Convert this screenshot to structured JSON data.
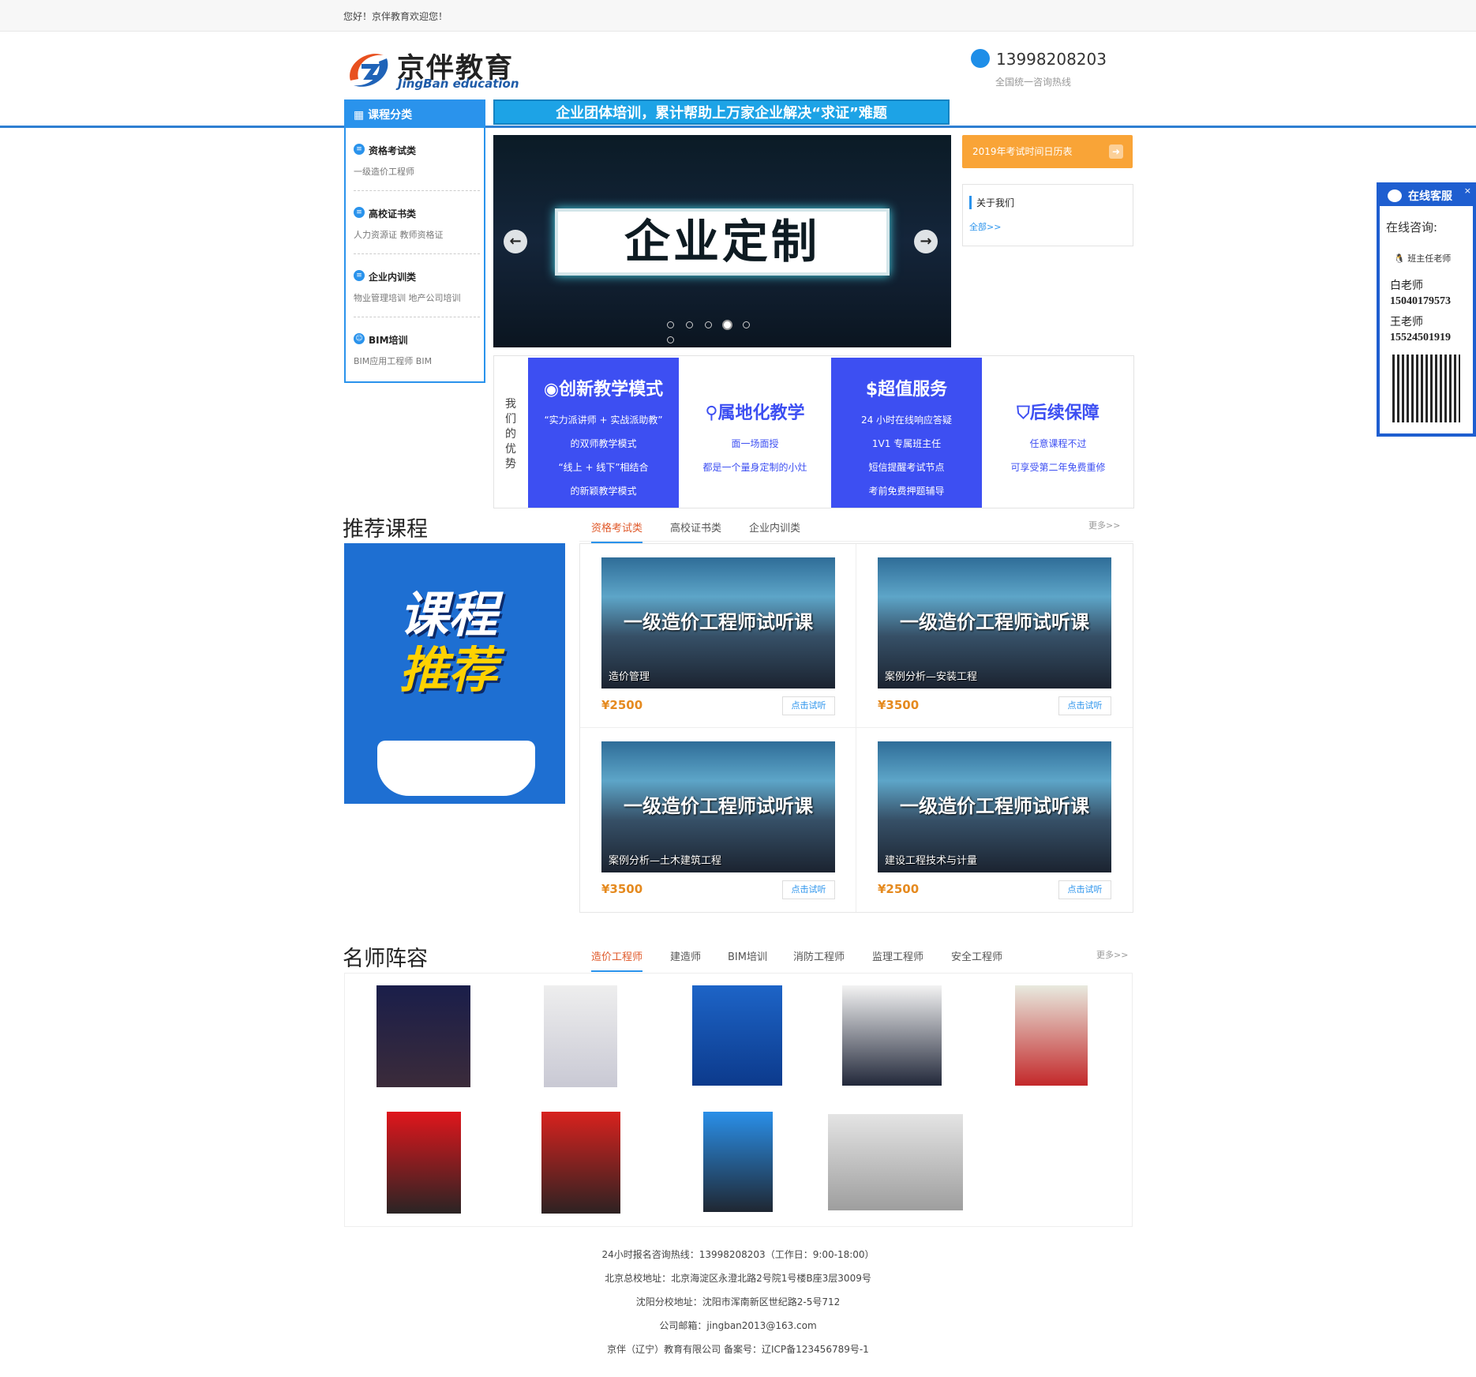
{
  "topbar": {
    "welcome": "您好！京伴教育欢迎您！"
  },
  "logo": {
    "cn": "京伴教育",
    "en": "JingBan education"
  },
  "hotline": {
    "number": "13998208203",
    "label": "全国统一咨询热线"
  },
  "category": {
    "title": "课程分类",
    "items": [
      {
        "title": "资格考试类",
        "sub": "一级造价工程师"
      },
      {
        "title": "高校证书类",
        "sub": "人力资源证  教师资格证"
      },
      {
        "title": "企业内训类",
        "sub": "物业管理培训  地产公司培训"
      },
      {
        "title": "BIM培训",
        "sub": "BIM应用工程师  BIM"
      }
    ]
  },
  "slogan": "企业团体培训，累计帮助上万家企业解决“求证”难题",
  "slider": {
    "headline": "企业定制",
    "prev": "←",
    "next": "→",
    "dots": 6,
    "active": 3
  },
  "calendar_button": "2019年考试时间日历表",
  "about": {
    "title": "关于我们",
    "more": "全部>>"
  },
  "advantages": {
    "side": "我们的优势",
    "cols": [
      {
        "title": "创新教学模式",
        "lines": [
          "“实力派讲师 + 实战派助教”",
          "的双师教学模式",
          "“线上 + 线下”相结合",
          "的新颖教学模式"
        ]
      },
      {
        "title": "属地化教学",
        "lines": [
          "面一场面授",
          "都是一个量身定制的小灶"
        ]
      },
      {
        "title": "超值服务",
        "lines": [
          "24 小时在线响应答疑",
          "1V1 专属班主任",
          "短信提醒考试节点",
          "考前免费押题辅导"
        ]
      },
      {
        "title": "后续保障",
        "lines": [
          "任意课程不过",
          "可享受第二年免费重修"
        ]
      }
    ]
  },
  "recommend": {
    "title": "推荐课程",
    "tabs": [
      "资格考试类",
      "高校证书类",
      "企业内训类"
    ],
    "more": "更多>>",
    "promo_line1": "课程",
    "promo_line2": "推荐",
    "courses": [
      {
        "banner": "一级造价工程师试听课",
        "sub": "造价管理",
        "price": "¥2500",
        "btn": "点击试听"
      },
      {
        "banner": "一级造价工程师试听课",
        "sub": "案例分析—安装工程",
        "price": "¥3500",
        "btn": "点击试听"
      },
      {
        "banner": "一级造价工程师试听课",
        "sub": "案例分析—土木建筑工程",
        "price": "¥3500",
        "btn": "点击试听"
      },
      {
        "banner": "一级造价工程师试听课",
        "sub": "建设工程技术与计量",
        "price": "¥2500",
        "btn": "点击试听"
      }
    ]
  },
  "teachers": {
    "title": "名师阵容",
    "tabs": [
      "造价工程师",
      "建造师",
      "BIM培训",
      "消防工程师",
      "监理工程师",
      "安全工程师"
    ],
    "more": "更多>>"
  },
  "footer": [
    "24小时报名咨询热线：13998208203（工作日：9:00-18:00）",
    "北京总校地址：北京海淀区永澄北路2号院1号楼B座3层3009号",
    "沈阳分校地址：沈阳市浑南新区世纪路2-5号712",
    "公司邮箱：jingban2013@163.com",
    "京伴（辽宁）教育有限公司    备案号：辽ICP备123456789号-1"
  ],
  "kefu": {
    "title": "在线客服",
    "close": "×",
    "consult": "在线咨询:",
    "qq": "班主任老师",
    "t1": "白老师",
    "p1": "15040179573",
    "t2": "王老师",
    "p2": "15524501919"
  },
  "colors": {
    "brand": "#2a93ec",
    "advantage_blue": "#3d4ff2",
    "accent_orange": "#f9a437",
    "price": "#e58a1f"
  }
}
